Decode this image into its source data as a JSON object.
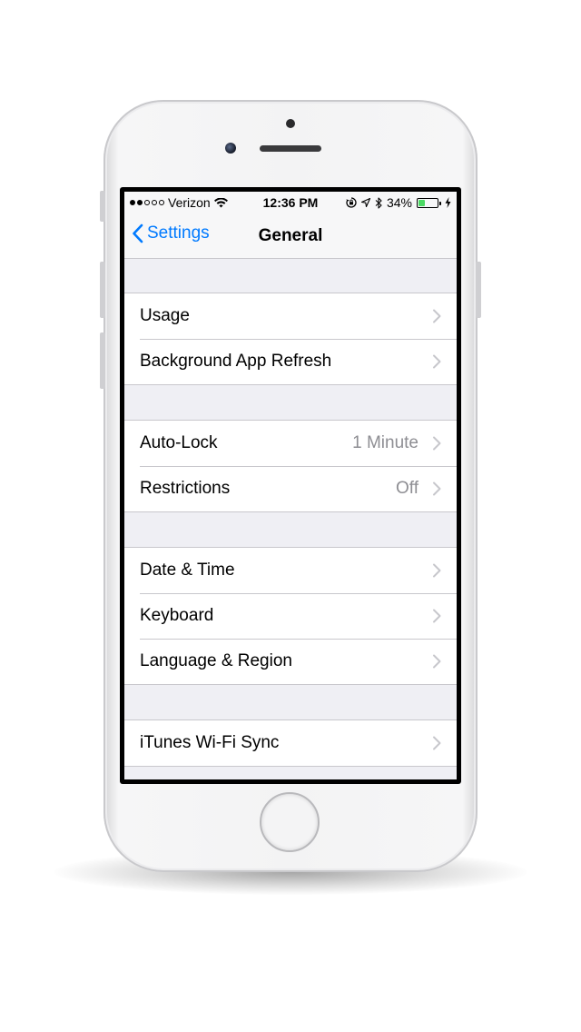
{
  "status_bar": {
    "carrier": "Verizon",
    "time": "12:36 PM",
    "battery_percent": "34%",
    "battery_level": 0.34,
    "signal_bars_filled": 2,
    "signal_bars_total": 5,
    "icons": [
      "wifi-icon",
      "orientation-lock-icon",
      "location-icon",
      "bluetooth-icon",
      "battery-icon",
      "charging-icon"
    ]
  },
  "nav": {
    "back_label": "Settings",
    "title": "General",
    "accent_color": "#007aff"
  },
  "groups": [
    {
      "items": [
        {
          "label": "Usage",
          "value": ""
        },
        {
          "label": "Background App Refresh",
          "value": ""
        }
      ]
    },
    {
      "items": [
        {
          "label": "Auto-Lock",
          "value": "1 Minute"
        },
        {
          "label": "Restrictions",
          "value": "Off"
        }
      ]
    },
    {
      "items": [
        {
          "label": "Date & Time",
          "value": ""
        },
        {
          "label": "Keyboard",
          "value": ""
        },
        {
          "label": "Language & Region",
          "value": ""
        }
      ]
    },
    {
      "items": [
        {
          "label": "iTunes Wi-Fi Sync",
          "value": ""
        }
      ]
    }
  ]
}
